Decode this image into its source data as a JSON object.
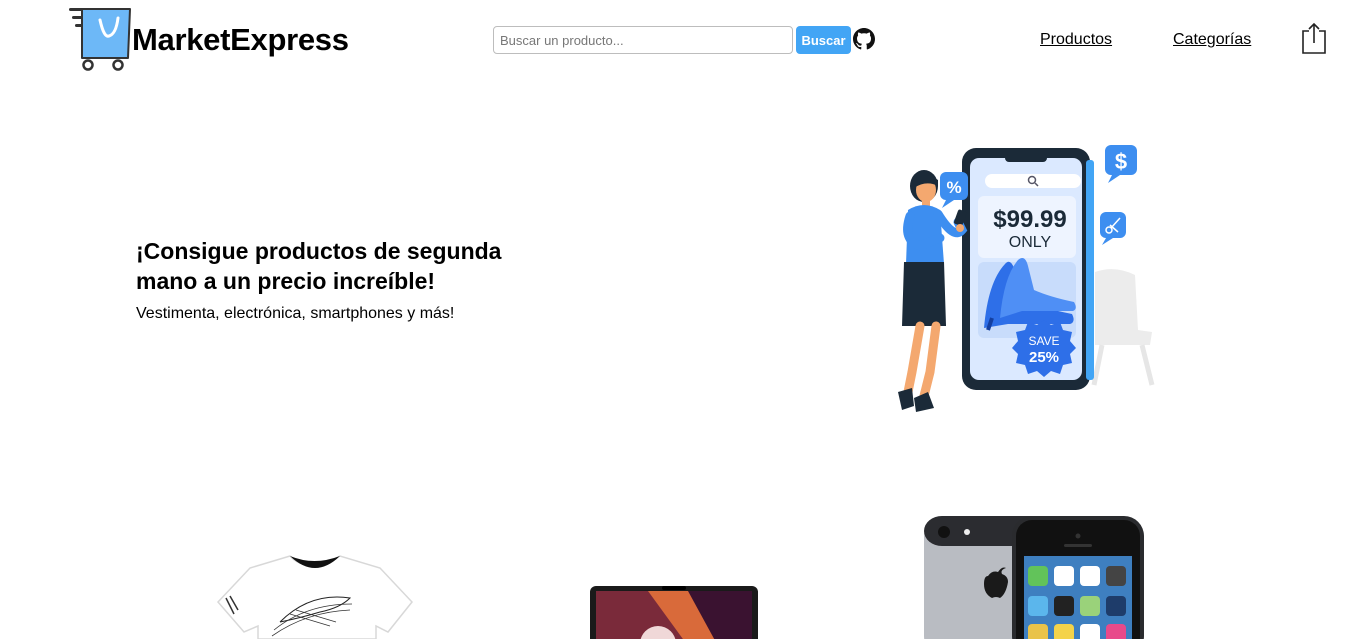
{
  "header": {
    "brand": "MarketExpress",
    "search": {
      "placeholder": "Buscar un producto...",
      "value": ""
    },
    "search_button": "Buscar",
    "nav": [
      {
        "label": "Productos"
      },
      {
        "label": "Categorías"
      }
    ]
  },
  "hero": {
    "title": "¡Consigue productos de segunda mano a un precio increíble!",
    "subtitle": "Vestimenta, electrónica, smartphones y más!",
    "illustration": {
      "price": "$99.99",
      "price_caption": "ONLY",
      "badge_line1": "SAVE",
      "badge_line2": "25%"
    }
  },
  "colors": {
    "accent": "#42a5f5",
    "dark": "#1b2a38",
    "phone_screen": "#dbe9ff"
  }
}
